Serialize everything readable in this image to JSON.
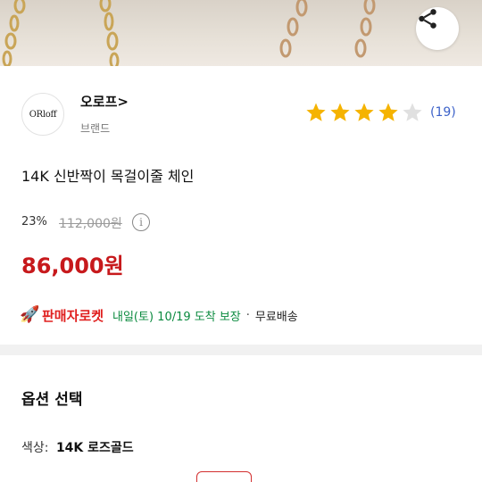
{
  "header": {
    "share_icon": "share-icon"
  },
  "brand": {
    "logo_text": "ORloff",
    "name": "오로프>",
    "sub_label": "브랜드"
  },
  "rating": {
    "stars_filled": 4,
    "stars_total": 5,
    "review_count": "(19)",
    "star_color": "#f5b301"
  },
  "product": {
    "title": "14K 신반짝이 목걸이줄 체인"
  },
  "pricing": {
    "discount": "23%",
    "original_price": "112,000원",
    "price": "86,000원",
    "price_color": "#c7191c",
    "info_icon": "info-icon"
  },
  "shipping": {
    "rocket_icon": "rocket-icon",
    "rocket_label": "판매자로켓",
    "delivery": "내일(토) 10/19 도착 보장",
    "separator": "·",
    "free_shipping": "무료배송"
  },
  "options": {
    "title": "옵션 선택",
    "color_label": "색상:",
    "color_value": "14K 로즈골드"
  }
}
